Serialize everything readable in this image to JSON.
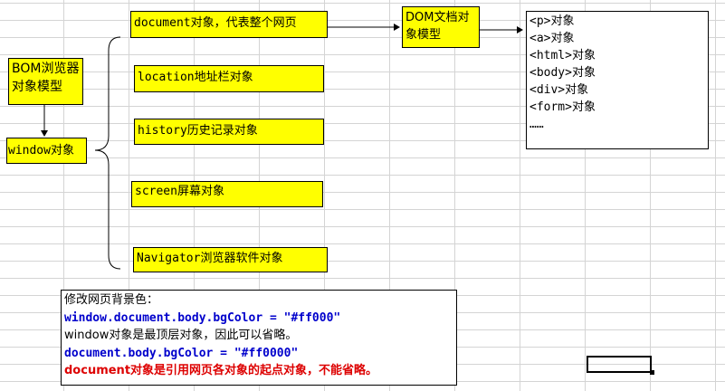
{
  "bom": {
    "title": "BOM浏览器\n对象模型",
    "window": "window对象"
  },
  "objects": [
    "document对象，代表整个网页",
    "location地址栏对象",
    "history历史记录对象",
    "screen屏幕对象",
    "Navigator浏览器软件对象"
  ],
  "dom": {
    "title": "DOM文档对\n象模型",
    "items": [
      "<p>对象",
      "<a>对象",
      "<html>对象",
      "<body>对象",
      "<div>对象",
      "<form>对象",
      "……"
    ]
  },
  "note": {
    "line1": "修改网页背景色：",
    "line2": "window.document.body.bgColor = \"#ff000\"",
    "line3": "window对象是最顶层对象，因此可以省略。",
    "line4": "document.body.bgColor = \"#ff0000\"",
    "line5": "document对象是引用网页各对象的起点对象，不能省略。"
  },
  "colors": {
    "box": "#ffff00",
    "code": "#0000cc",
    "warn": "#dd0000",
    "grid": "#d4d4d4"
  }
}
